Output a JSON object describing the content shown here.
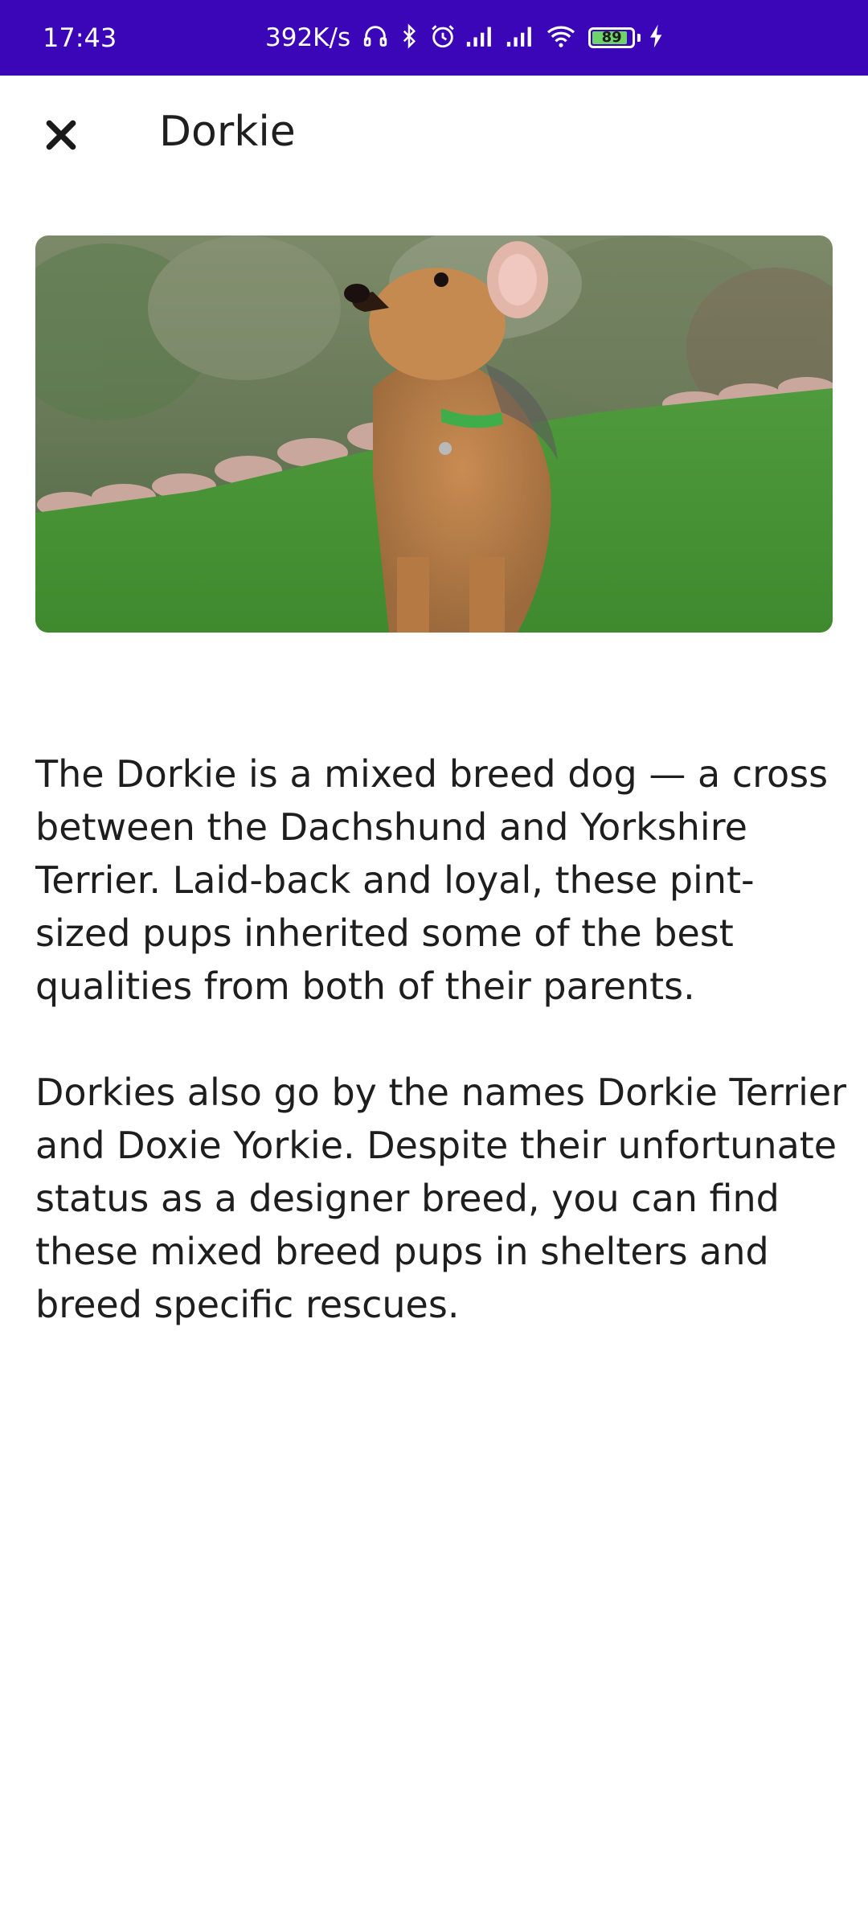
{
  "status_bar": {
    "time": "17:43",
    "net_speed": "392K/s",
    "battery_level": "89",
    "battery_fraction": 0.89,
    "icons": [
      "headphones-icon",
      "bluetooth-icon",
      "alarm-icon",
      "signal-icon",
      "signal-icon",
      "wifi-icon",
      "battery-icon",
      "charging-icon"
    ],
    "colors": {
      "background": "#3a06b8",
      "battery": "#6fd36b"
    }
  },
  "app_bar": {
    "close_icon": "close-icon",
    "title": "Dorkie"
  },
  "hero_image": {
    "subject": "dog-photo"
  },
  "article": {
    "paragraphs": [
      "The Dorkie is a mixed breed dog — a cross between the Dachshund and Yorkshire Terrier. Laid-back and loyal, these pint-sized pups inherited some of the best qualities from both of their parents.",
      "Dorkies also go by the names Dorkie Terrier and Doxie Yorkie. Despite their unfortunate status as a designer breed, you can find these mixed breed pups in shelters and breed specific rescues."
    ]
  }
}
